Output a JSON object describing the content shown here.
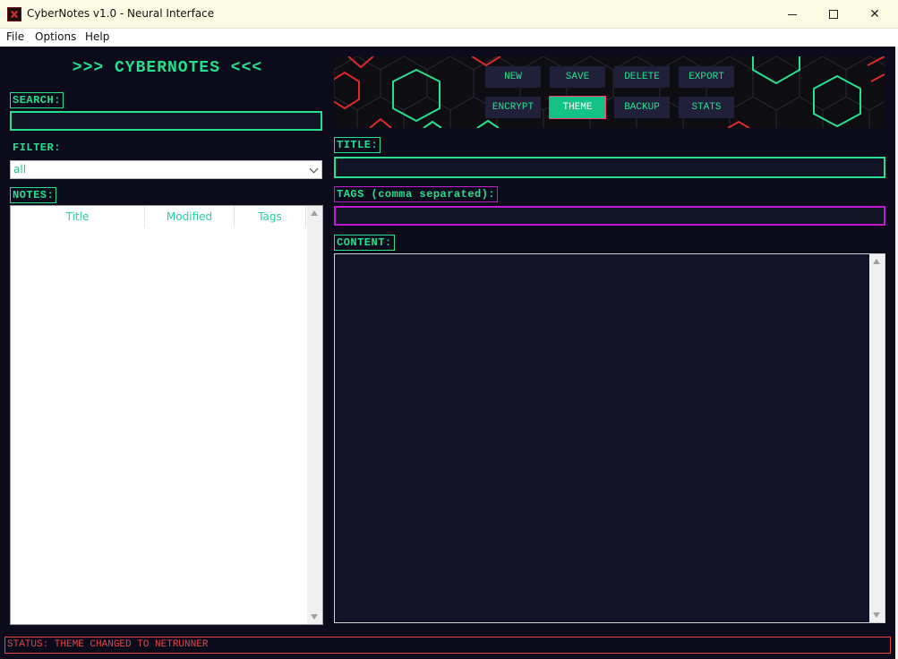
{
  "window": {
    "title": "CyberNotes v1.0 - Neural Interface"
  },
  "menu": {
    "items": [
      "File",
      "Options",
      "Help"
    ]
  },
  "sidebar": {
    "app_title": ">>> CYBERNOTES <<<",
    "search_label": "SEARCH:",
    "search_value": "",
    "filter_label": "FILTER:",
    "filter_selected": "all",
    "notes_label": "NOTES:",
    "columns": [
      "Title",
      "Modified",
      "Tags"
    ],
    "rows": []
  },
  "toolbar": {
    "buttons": [
      {
        "label": "NEW",
        "active": false
      },
      {
        "label": "SAVE",
        "active": false
      },
      {
        "label": "DELETE",
        "active": false
      },
      {
        "label": "EXPORT",
        "active": false
      },
      {
        "label": "ENCRYPT",
        "active": false
      },
      {
        "label": "THEME",
        "active": true
      },
      {
        "label": "BACKUP",
        "active": false
      },
      {
        "label": "STATS",
        "active": false
      }
    ]
  },
  "editor": {
    "title_label": "TITLE:",
    "title_value": "",
    "tags_label": "TAGS (comma separated):",
    "tags_value": "",
    "content_label": "CONTENT:",
    "content_value": ""
  },
  "status": {
    "text": "STATUS: THEME CHANGED TO NETRUNNER"
  },
  "colors": {
    "accent": "#26e08e",
    "tags_accent": "#c21ad0",
    "status_accent": "#e04848",
    "background": "#0b0b1c",
    "button_bg": "#20203a",
    "active_button_bg": "#14c285"
  }
}
